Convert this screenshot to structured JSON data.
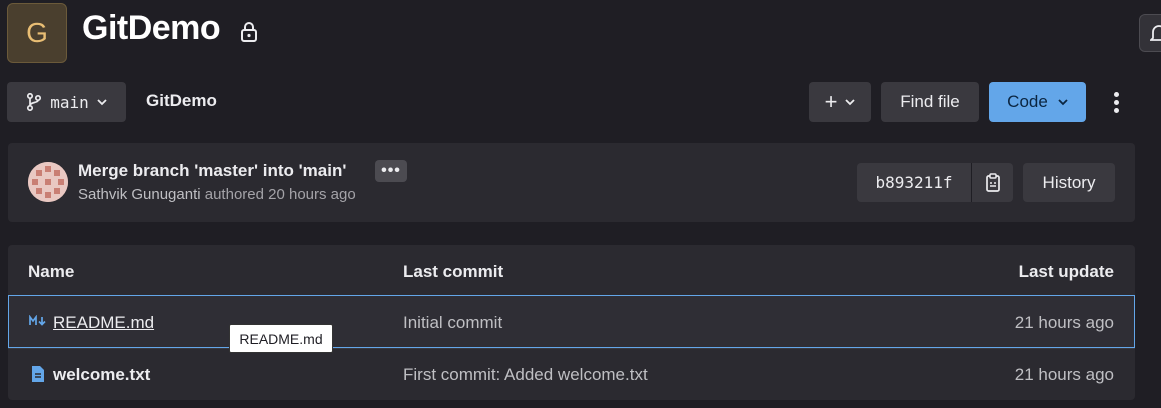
{
  "project": {
    "avatar_letter": "G",
    "name": "GitDemo"
  },
  "toolbar": {
    "branch": "main",
    "breadcrumb": "GitDemo",
    "plus_label": "+",
    "find_file": "Find file",
    "code": "Code"
  },
  "commit": {
    "message": "Merge branch 'master' into 'main'",
    "ellipsis": "•••",
    "author": "Sathvik Gunuganti",
    "authored_text": " authored 20 hours ago",
    "sha": "b893211f",
    "history": "History"
  },
  "table": {
    "headers": {
      "name": "Name",
      "last_commit": "Last commit",
      "last_update": "Last update"
    },
    "rows": [
      {
        "name": "README.md",
        "commit": "Initial commit",
        "updated": "21 hours ago",
        "icon": "markdown-icon"
      },
      {
        "name": "welcome.txt",
        "commit": "First commit: Added welcome.txt",
        "updated": "21 hours ago",
        "icon": "file-text-icon"
      }
    ],
    "tooltip": "README.md"
  },
  "colors": {
    "background": "#1f1e24",
    "panel": "#2b2a30",
    "accent": "#63a6e9"
  }
}
